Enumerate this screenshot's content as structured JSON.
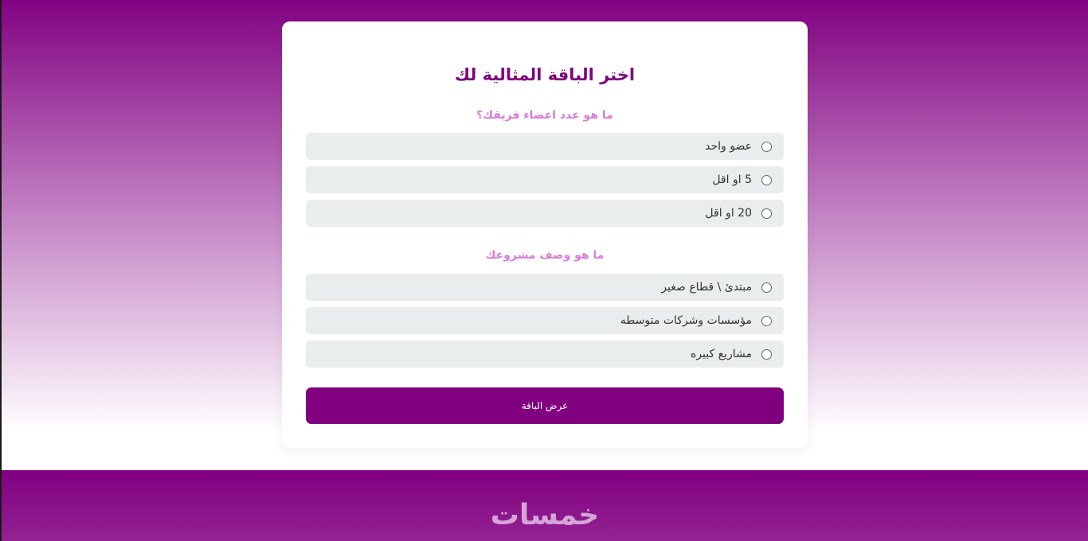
{
  "form": {
    "title": "اختر الباقة المثالية لك",
    "question1": {
      "label": "ما هو عدد اعضاء فريقك؟",
      "options": [
        "عضو واحد",
        "5 او اقل",
        "20 او اقل"
      ]
    },
    "question2": {
      "label": "ما هو وصف مشروعك",
      "options": [
        "مبتدئ \\ قطاع صغير",
        "مؤسسات وشركات متوسطه",
        "مشاريع كبيره"
      ]
    },
    "submit_label": "عرض الباقة"
  },
  "footer": {
    "logo_text": "خمسات"
  },
  "colors": {
    "accent": "#800080",
    "question": "#d87bd8",
    "option_bg": "#eaeded"
  }
}
